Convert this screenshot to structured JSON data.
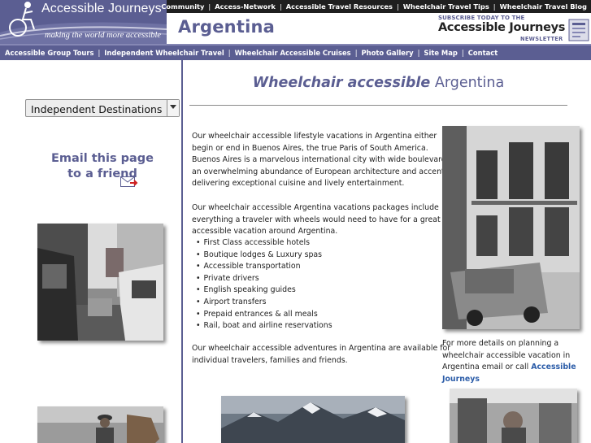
{
  "site": {
    "brand": "Accessible Journeys",
    "tagline": "making the world more accessible"
  },
  "top_nav": [
    "Community",
    "Access-Network",
    "Accessible Travel Resources",
    "Wheelchair Travel Tips",
    "Wheelchair Travel Blog"
  ],
  "page_title": "Argentina",
  "subscribe": {
    "line1": "SUBSCRIBE TODAY TO THE",
    "line2": "Accessible Journeys",
    "line3": "NEWSLETTER"
  },
  "main_nav": [
    "Accessible Group Tours",
    "Independent Wheelchair Travel",
    "Wheelchair Accessible Cruises",
    "Photo Gallery",
    "Site Map",
    "Contact"
  ],
  "sidebar": {
    "destinations_select": {
      "selected": "Independent Destinations"
    },
    "email_link": {
      "line1": "Email this page",
      "line2": "to a friend"
    }
  },
  "content": {
    "heading_italic": "Wheelchair accessible",
    "heading_rest": "Argentina",
    "para1": [
      "Our wheelchair accessible lifestyle vacations in Argentina either",
      "begin or end in Buenos Aires, the true Paris of South America.",
      "Buenos Aires is a marvelous international city with wide boulevards,",
      "an overwhelming abundance of European architecture and accents,",
      "delivering exceptional cuisine and lively entertainment."
    ],
    "para2": [
      "Our wheelchair accessible Argentina vacations packages include",
      "everything a traveler with wheels would need to have for a great",
      "accessible vacation around Argentina."
    ],
    "bullets": [
      "First Class accessible hotels",
      "Boutique lodges & Luxury spas",
      "Accessible transportation",
      "Private drivers",
      "English speaking guides",
      "Airport transfers",
      "Prepaid entrances & all meals",
      "Rail, boat and airline reservations"
    ],
    "para3": [
      "Our wheelchair accessible adventures in Argentina are available for",
      "individual travelers, families and friends."
    ],
    "caption": {
      "line1": "For more details on planning a",
      "line2": "wheelchair accessible vacation in",
      "line3_text": "Argentina email or call ",
      "line3_link": "Accessible",
      "line4_link": "Journeys"
    }
  },
  "colors": {
    "brand": "#5b5e92",
    "top_nav_bg": "#1f1f1f",
    "link": "#2b5ca8"
  }
}
